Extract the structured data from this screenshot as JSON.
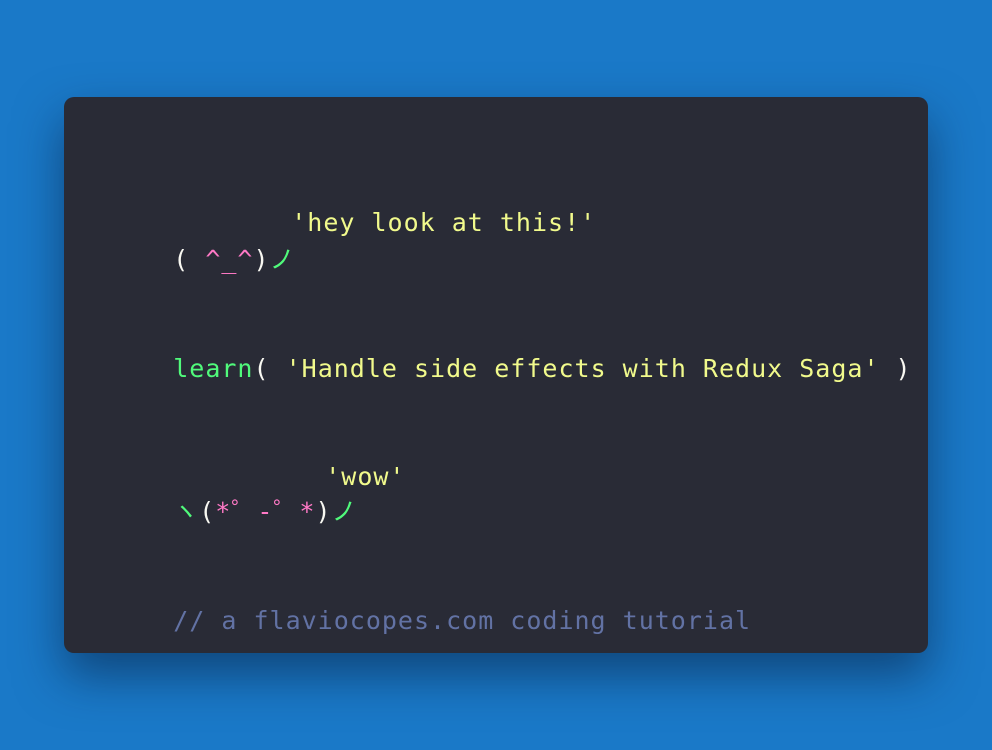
{
  "code": {
    "line1": "'hey look at this!'",
    "kaomoji1": {
      "open": "( ",
      "face": "^_^",
      "close": ")",
      "arm": "ノ"
    },
    "learn": {
      "fn": "learn",
      "open": "( ",
      "arg": "'Handle side effects with Redux Saga'",
      "close": " )"
    },
    "line_wow": "'wow'",
    "kaomoji2": {
      "arm_left": "ヽ",
      "open": "(",
      "face": "*゜-゜*",
      "close": ")",
      "arm_right": "ノ"
    },
    "comment": "// a flaviocopes.com coding tutorial"
  },
  "colors": {
    "background": "#1a79c8",
    "card": "#292b36",
    "string": "#f1fa8c",
    "function": "#50fa7b",
    "punctuation": "#f8f8f2",
    "face": "#ff79c6",
    "comment": "#6272a4"
  }
}
